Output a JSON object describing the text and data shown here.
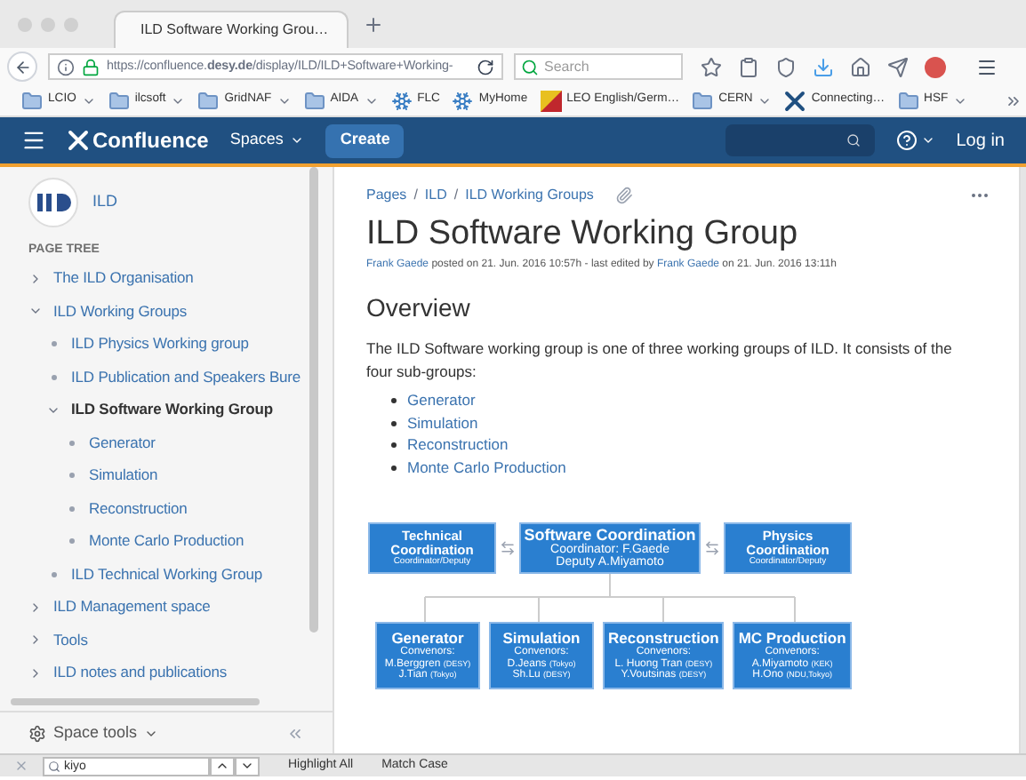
{
  "browser": {
    "tab_title": "ILD Software Working Grou…",
    "url": "https://confluence.**desy.de**/display/ILD/ILD+Software+Working-",
    "search_placeholder": "Search",
    "bookmarks": [
      {
        "label": "LCIO",
        "kind": "folder",
        "dropdown": true
      },
      {
        "label": "ilcsoft",
        "kind": "folder",
        "dropdown": true
      },
      {
        "label": "GridNAF",
        "kind": "folder",
        "dropdown": true
      },
      {
        "label": "AIDA",
        "kind": "folder",
        "dropdown": true
      },
      {
        "label": "FLC",
        "kind": "site",
        "dropdown": false
      },
      {
        "label": "MyHome",
        "kind": "site",
        "dropdown": false
      },
      {
        "label": "LEO English/Germ…",
        "kind": "leo",
        "dropdown": false
      },
      {
        "label": "CERN",
        "kind": "folder",
        "dropdown": true
      },
      {
        "label": "Connecting…",
        "kind": "confluence",
        "dropdown": false
      },
      {
        "label": "HSF",
        "kind": "folder",
        "dropdown": true
      }
    ]
  },
  "header": {
    "logo": "Confluence",
    "spaces": "Spaces",
    "create": "Create",
    "login": "Log in"
  },
  "sidebar": {
    "space_name": "ILD",
    "tree_heading": "PAGE TREE",
    "tree": [
      {
        "label": "The ILD Organisation",
        "kind": "branch",
        "expanded": false,
        "selected": false
      },
      {
        "label": "ILD Working Groups",
        "kind": "branch",
        "expanded": true,
        "selected": false,
        "children": [
          {
            "label": "ILD Physics Working group",
            "kind": "leaf",
            "selected": false
          },
          {
            "label": "ILD Publication and Speakers Bure",
            "kind": "leaf",
            "selected": false
          },
          {
            "label": "ILD Software Working Group",
            "kind": "branch",
            "expanded": true,
            "selected": true,
            "children": [
              {
                "label": "Generator",
                "kind": "leaf",
                "selected": false
              },
              {
                "label": "Simulation",
                "kind": "leaf",
                "selected": false
              },
              {
                "label": "Reconstruction",
                "kind": "leaf",
                "selected": false
              },
              {
                "label": "Monte Carlo Production",
                "kind": "leaf",
                "selected": false
              }
            ]
          },
          {
            "label": "ILD Technical Working Group",
            "kind": "leaf",
            "selected": false
          }
        ]
      },
      {
        "label": "ILD Management space",
        "kind": "branch",
        "expanded": false,
        "selected": false
      },
      {
        "label": "Tools",
        "kind": "branch",
        "expanded": false,
        "selected": false
      },
      {
        "label": "ILD notes and publications",
        "kind": "branch",
        "expanded": false,
        "selected": false
      }
    ],
    "space_tools": "Space tools"
  },
  "page": {
    "breadcrumbs": [
      "Pages",
      "ILD",
      "ILD Working Groups"
    ],
    "breadcrumb_separator": "/",
    "title": "ILD Software Working Group",
    "meta": {
      "author": "Frank Gaede",
      "posted": "posted on 21. Jun. 2016 10:57h - last edited by",
      "editor": "Frank Gaede",
      "edited": "on 21. Jun. 2016 13:11h"
    },
    "heading": "Overview",
    "paragraph": "The ILD Software working group is one of three working groups of ILD. It consists of the four sub-groups:",
    "links": [
      "Generator",
      "Simulation",
      "Reconstruction",
      "Monte Carlo Production"
    ],
    "diagram": {
      "top": [
        {
          "title": "Technical Coordination",
          "lines": [
            "Coordinator/Deputy"
          ],
          "kind": "side"
        },
        {
          "title": "Software Coordination",
          "lines": [
            "Coordinator: F.Gaede",
            "Deputy  A.Miyamoto"
          ],
          "kind": "main"
        },
        {
          "title": "Physics Coordination",
          "lines": [
            "Coordinator/Deputy"
          ],
          "kind": "side"
        }
      ],
      "bottom": [
        {
          "title": "Generator",
          "role": "Convenors:",
          "members": [
            {
              "name": "M.Berggren",
              "org": "(DESY)"
            },
            {
              "name": "J.Tian",
              "org": "(Tokyo)"
            }
          ]
        },
        {
          "title": "Simulation",
          "role": "Convenors:",
          "members": [
            {
              "name": "D.Jeans",
              "org": "(Tokyo)"
            },
            {
              "name": "Sh.Lu",
              "org": "(DESY)"
            }
          ]
        },
        {
          "title": "Reconstruction",
          "role": "Convenors:",
          "members": [
            {
              "name": "L. Huong Tran",
              "org": "(DESY)"
            },
            {
              "name": "Y.Voutsinas",
              "org": "(DESY)"
            }
          ]
        },
        {
          "title": "MC Production",
          "role": "Convenors:",
          "members": [
            {
              "name": "A.Miyamoto",
              "org": "(KEK)"
            },
            {
              "name": "H.Ono",
              "org": "(NDU,Tokyo)"
            }
          ]
        }
      ]
    }
  },
  "find_bar": {
    "value": "kiyo",
    "highlight_all": "Highlight All",
    "match_case": "Match Case"
  }
}
